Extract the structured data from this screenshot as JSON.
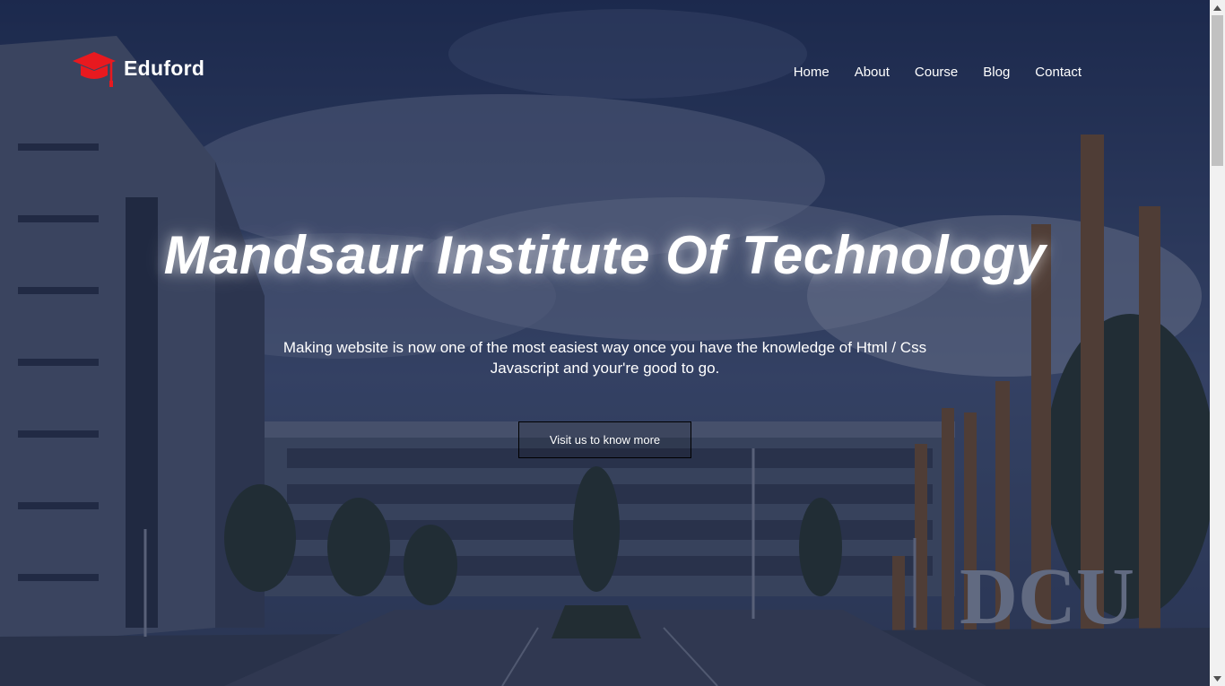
{
  "brand": {
    "name": "Eduford",
    "accent": "#e8191f"
  },
  "nav": {
    "items": [
      "Home",
      "About",
      "Course",
      "Blog",
      "Contact"
    ]
  },
  "hero": {
    "title": "Mandsaur Institute Of Technology",
    "subtitle_line1": "Making website is now one of the most easiest way once you have the knowledge of Html / Css",
    "subtitle_line2": "Javascript and your're good to go.",
    "cta_label": "Visit us to know more",
    "campus_sign": "DCU"
  },
  "icons": {
    "logo": "graduation-cap-icon",
    "scroll_up": "arrow-up-icon",
    "scroll_down": "arrow-down-icon"
  }
}
